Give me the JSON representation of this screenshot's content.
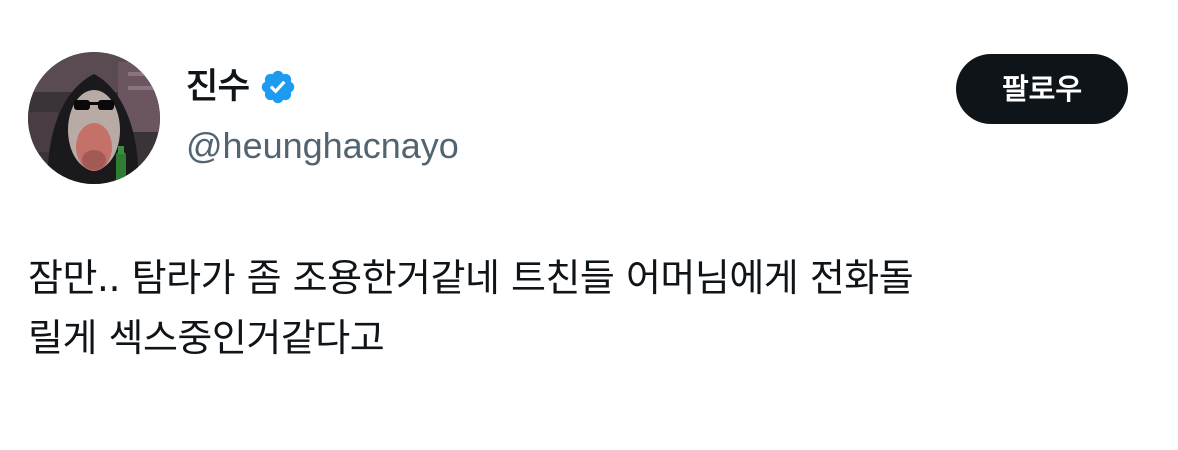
{
  "tweet": {
    "author": {
      "display_name": "진수",
      "handle": "@heunghacnayo",
      "verified": true,
      "avatar_icon": "profile-avatar",
      "verified_icon": "verified-badge-icon"
    },
    "follow_button": {
      "label": "팔로우"
    },
    "text_line_1": "잠만.. 탐라가 좀 조용한거같네 트친들 어머님에게 전화돌",
    "text_line_2": "릴게 섹스중인거같다고"
  },
  "colors": {
    "text_primary": "#0f1419",
    "text_secondary": "#536471",
    "verified_blue": "#1d9bf0",
    "button_bg": "#0f1419",
    "button_text": "#ffffff",
    "background": "#ffffff"
  }
}
